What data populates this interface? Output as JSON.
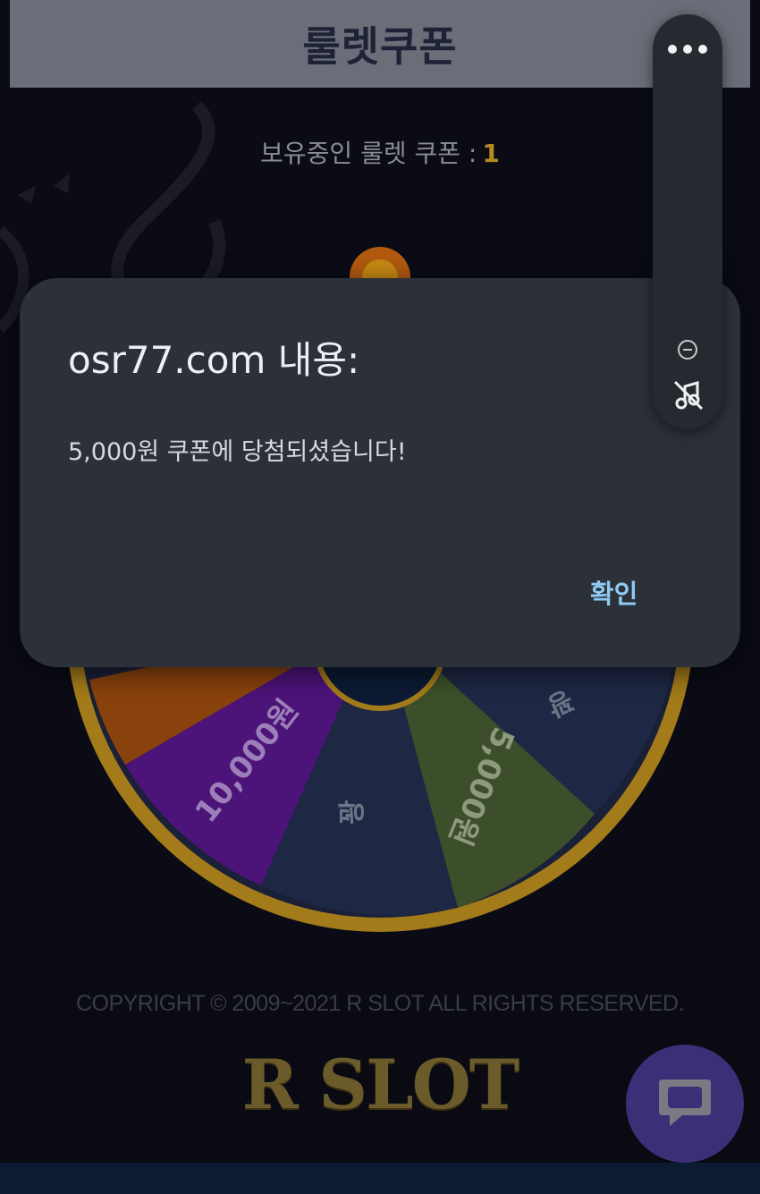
{
  "header": {
    "title": "룰렛쿠폰"
  },
  "coupon": {
    "label": "보유중인 룰렛 쿠폰 :",
    "count": "1"
  },
  "wheel": {
    "segments": [
      {
        "label": "10,000원",
        "color": "#4c1378"
      },
      {
        "label": "꽝",
        "color": "#1c2440"
      },
      {
        "label": "5,000원",
        "color": "#3d4f2a"
      },
      {
        "label": "꽝",
        "color": "#1c2440"
      }
    ],
    "rim_color": "#a37b1a"
  },
  "dialog": {
    "title": "osr77.com 내용:",
    "message": "5,000원 쿠폰에 당첨되셨습니다!",
    "confirm_label": "확인"
  },
  "footer": {
    "copyright": "COPYRIGHT © 2009~2021 R SLOT ALL RIGHTS RESERVED.",
    "logo": "R SLOT"
  },
  "colors": {
    "accent": "#8fcbf5",
    "coupon_count": "#b38b24",
    "chat": "#3c2f78"
  },
  "icons": {
    "more": "more-dots-icon",
    "minimize": "minus-circle-icon",
    "music": "music-off-icon",
    "chat": "chat-bubble-icon"
  }
}
